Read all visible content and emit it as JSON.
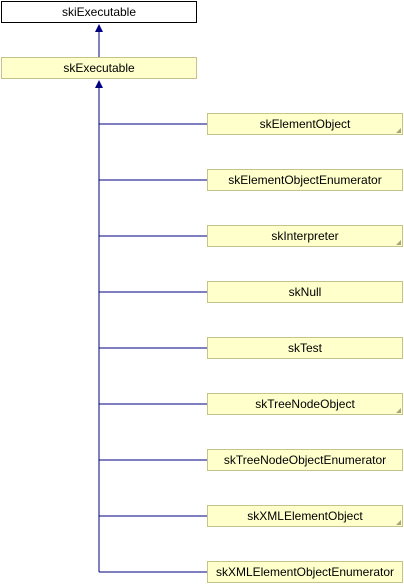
{
  "edge_color": "#000080",
  "root": {
    "label": "skiExecutable"
  },
  "base": {
    "label": "skExecutable"
  },
  "children": [
    {
      "label": "skElementObject",
      "has_more": true
    },
    {
      "label": "skElementObjectEnumerator",
      "has_more": false
    },
    {
      "label": "skInterpreter",
      "has_more": true
    },
    {
      "label": "skNull",
      "has_more": false
    },
    {
      "label": "skTest",
      "has_more": false
    },
    {
      "label": "skTreeNodeObject",
      "has_more": true
    },
    {
      "label": "skTreeNodeObjectEnumerator",
      "has_more": false
    },
    {
      "label": "skXMLElementObject",
      "has_more": true
    },
    {
      "label": "skXMLElementObjectEnumerator",
      "has_more": false
    }
  ]
}
